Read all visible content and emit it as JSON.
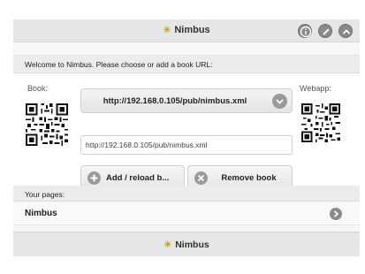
{
  "header": {
    "title": "Nimbus",
    "buttons": [
      "info-icon",
      "edit-icon",
      "up-icon"
    ]
  },
  "panel": {
    "welcome_text": "Welcome to Nimbus. Please choose or add a book URL:",
    "book_label": "Book:",
    "webapp_label": "Webapp:",
    "book_select_value": "http://192.168.0.105/pub/nimbus.xml",
    "url_input_value": "http://192.168.0.105/pub/nimbus.xml",
    "add_button_label": "Add / reload b...",
    "remove_button_label": "Remove book"
  },
  "pages": {
    "header": "Your pages:",
    "items": [
      {
        "label": "Nimbus"
      }
    ]
  },
  "footer": {
    "title": "Nimbus"
  },
  "colors": {
    "accent_icon": "#d4a017",
    "icon_gray": "#8a8a8a"
  }
}
